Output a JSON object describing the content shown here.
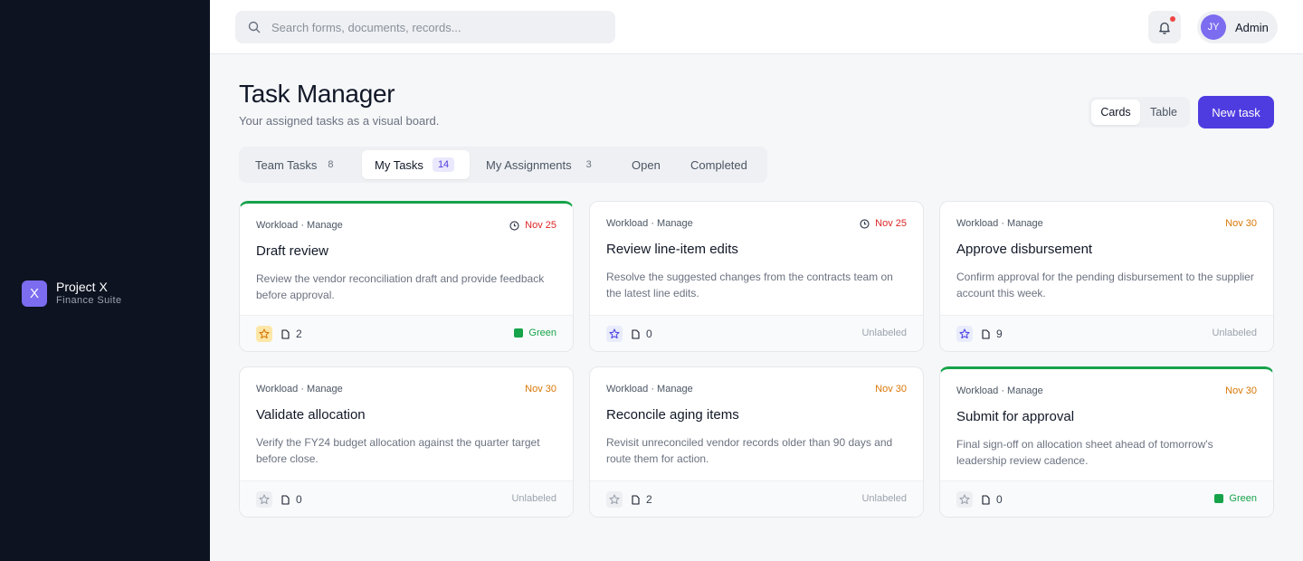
{
  "brand": {
    "logo_letter": "X",
    "name": "Project X",
    "subtitle": "Finance Suite"
  },
  "search": {
    "placeholder": "Search forms, documents, records..."
  },
  "user": {
    "initials": "JY",
    "name": "Admin"
  },
  "page": {
    "title": "Task Manager",
    "subtitle": "Your assigned tasks as a visual board."
  },
  "view_toggle": {
    "cards": "Cards",
    "table": "Table",
    "active": "Cards"
  },
  "new_task_label": "New task",
  "tabs": [
    {
      "label": "Team Tasks",
      "count": "8"
    },
    {
      "label": "My Tasks",
      "count": "14",
      "active": true
    },
    {
      "label": "My Assignments",
      "count": "3"
    },
    {
      "label": "Open"
    },
    {
      "label": "Completed"
    }
  ],
  "cards": [
    {
      "meta": "Workload · Manage",
      "due": "Nov 25",
      "title": "Draft review",
      "description": "Review the vendor reconciliation draft and provide feedback before approval.",
      "attachments": "2",
      "label": "Green"
    },
    {
      "meta": "Workload · Manage",
      "due": "Nov 25",
      "title": "Review line-item edits",
      "description": "Resolve the suggested changes from the contracts team on the latest line edits.",
      "attachments": "0",
      "label": "Unlabeled"
    },
    {
      "meta": "Workload · Manage",
      "due": "Nov 30",
      "title": "Approve disbursement",
      "description": "Confirm approval for the pending disbursement to the supplier account this week.",
      "attachments": "9",
      "label": "Unlabeled"
    },
    {
      "meta": "Workload · Manage",
      "due": "Nov 30",
      "title": "Validate allocation",
      "description": "Verify the FY24 budget allocation against the quarter target before close.",
      "attachments": "0",
      "label": "Unlabeled"
    },
    {
      "meta": "Workload · Manage",
      "due": "Nov 30",
      "title": "Reconcile aging items",
      "description": "Revisit unreconciled vendor records older than 90 days and route them for action.",
      "attachments": "2",
      "label": "Unlabeled"
    },
    {
      "meta": "Workload · Manage",
      "due": "Nov 30",
      "title": "Submit for approval",
      "description": "Final sign-off on allocation sheet ahead of tomorrow's leadership review cadence.",
      "attachments": "0",
      "label": "Green"
    }
  ],
  "colors": {
    "sidebar": "#0d1321",
    "accent": "#4f3ce0",
    "brand": "#7b6cf0",
    "overdue": "#dc2626",
    "upcoming": "#d97706",
    "label_green": "#16a34a"
  }
}
